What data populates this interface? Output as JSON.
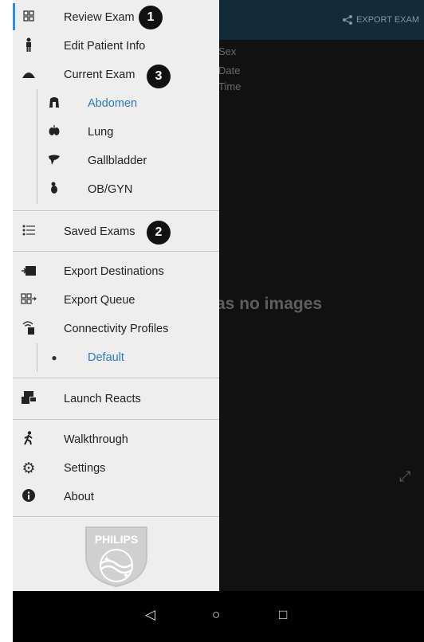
{
  "background": {
    "export_label": "EXPORT EXAM",
    "meta": [
      "Sex",
      "Date",
      "Time"
    ],
    "empty_text": "as no images"
  },
  "drawer": {
    "review_exam": "Review Exam",
    "edit_patient": "Edit Patient Info",
    "current_exam": "Current Exam",
    "exam_types": [
      "Abdomen",
      "Lung",
      "Gallbladder",
      "OB/GYN"
    ],
    "saved_exams": "Saved Exams",
    "export_destinations": "Export Destinations",
    "export_queue": "Export Queue",
    "connectivity_profiles": "Connectivity Profiles",
    "profile_default": "Default",
    "launch_reacts": "Launch Reacts",
    "walkthrough": "Walkthrough",
    "settings": "Settings",
    "about": "About"
  },
  "badges": [
    "1",
    "2",
    "3"
  ],
  "logo_text": "PHILIPS",
  "colors": {
    "accent": "#2f8cde",
    "selected_text": "#2b7ac2",
    "drawer_bg": "#eeeeee"
  },
  "navbar_icons": [
    "back-icon",
    "home-icon",
    "recents-icon"
  ]
}
